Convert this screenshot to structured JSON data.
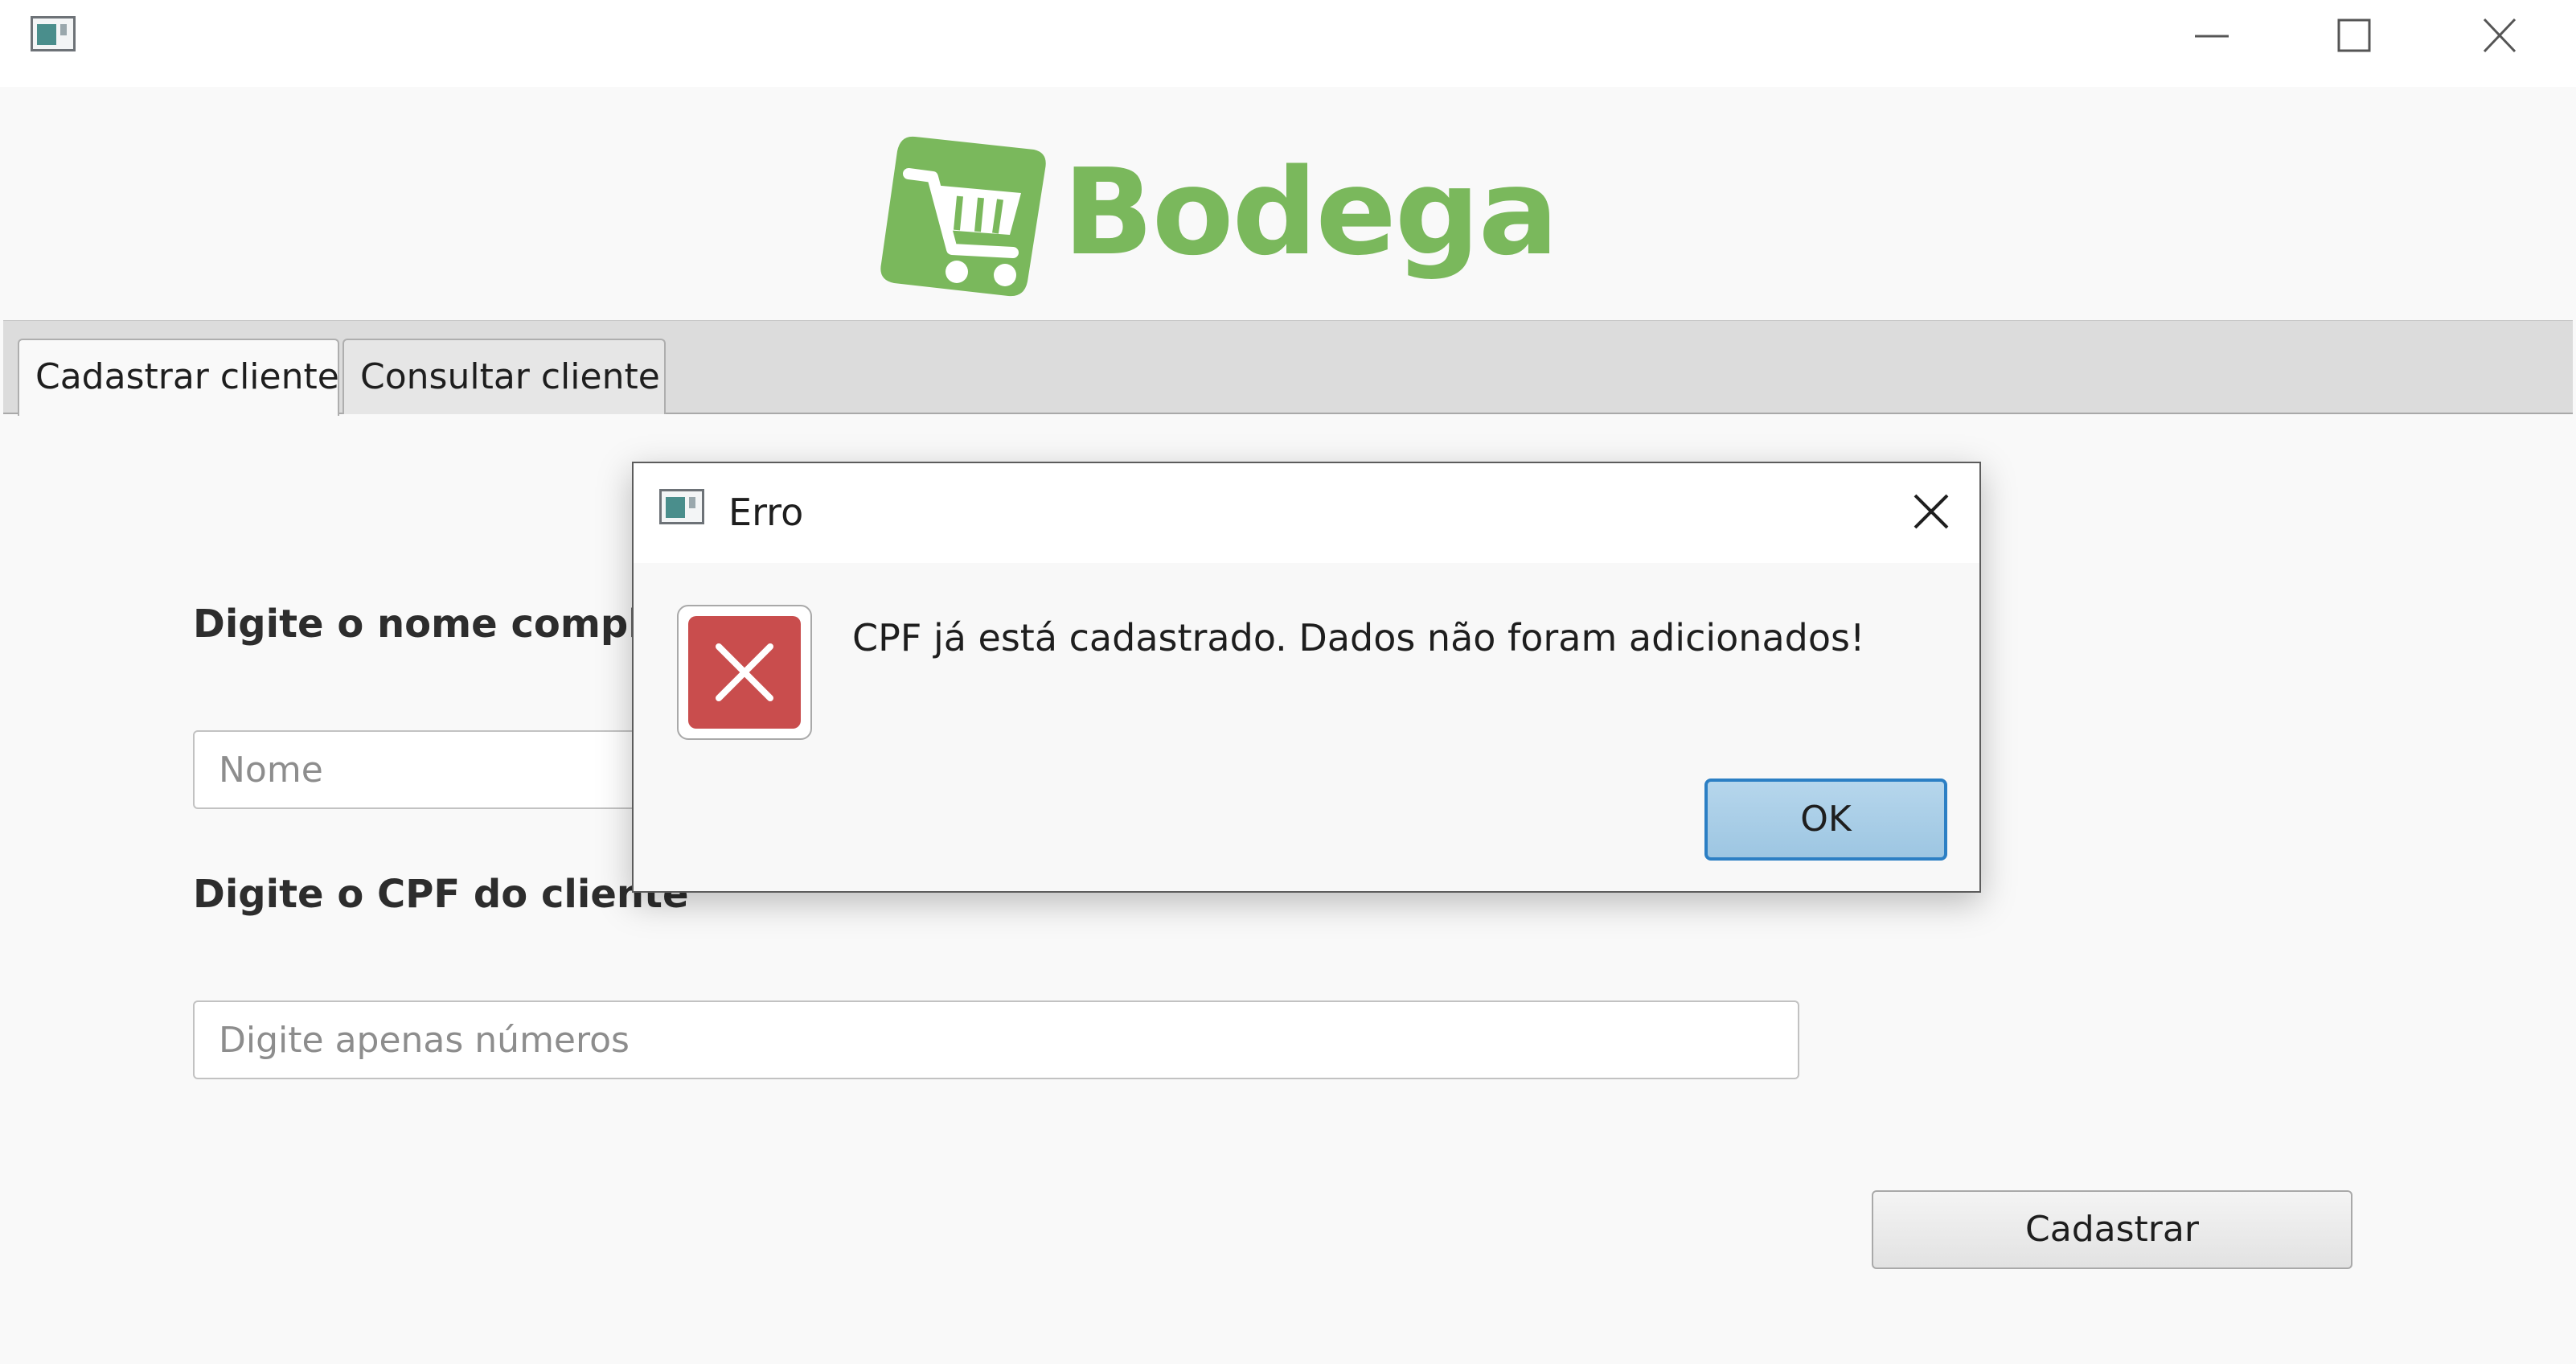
{
  "window": {
    "controls": [
      "minimize-icon",
      "maximize-icon",
      "close-icon"
    ]
  },
  "logo": {
    "text": "Bodega",
    "icon": "shopping-cart-icon",
    "color": "#7ab85c"
  },
  "tabs": [
    {
      "label": "Cadastrar cliente",
      "selected": true
    },
    {
      "label": "Consultar cliente",
      "selected": false
    }
  ],
  "form": {
    "nome_label": "Digite o nome completo",
    "nome_placeholder": "Nome",
    "cpf_label": "Digite o CPF do cliente",
    "cpf_placeholder": "Digite apenas números",
    "submit_label": "Cadastrar"
  },
  "dialog": {
    "title": "Erro",
    "message": "CPF já está cadastrado. Dados não foram adicionados!",
    "icon": "error-icon",
    "ok_label": "OK",
    "accent_color": "#2c7fc4",
    "error_color": "#c94d4d"
  }
}
